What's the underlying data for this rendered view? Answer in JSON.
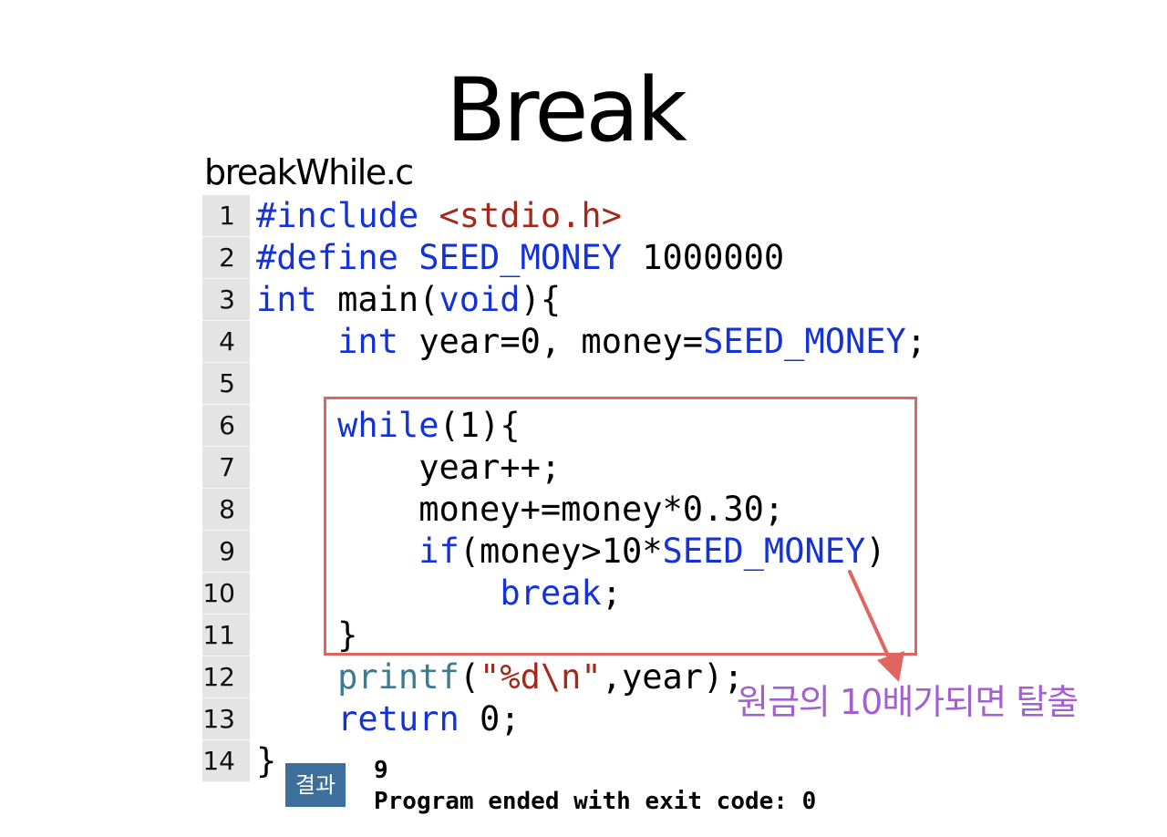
{
  "slide": {
    "title": "Break",
    "filename": "breakWhile.c"
  },
  "code": {
    "lines": [
      {
        "num": "1",
        "tokens": [
          {
            "t": "#include ",
            "c": "kw"
          },
          {
            "t": "<stdio.h>",
            "c": "str"
          }
        ]
      },
      {
        "num": "2",
        "tokens": [
          {
            "t": "#define SEED_MONEY ",
            "c": "kw"
          },
          {
            "t": "1000000",
            "c": ""
          }
        ]
      },
      {
        "num": "3",
        "tokens": [
          {
            "t": "int",
            "c": "kw"
          },
          {
            "t": " main(",
            "c": ""
          },
          {
            "t": "void",
            "c": "kw"
          },
          {
            "t": "){",
            "c": ""
          }
        ]
      },
      {
        "num": "4",
        "tokens": [
          {
            "t": "    ",
            "c": ""
          },
          {
            "t": "int",
            "c": "kw"
          },
          {
            "t": " year=0, money=",
            "c": ""
          },
          {
            "t": "SEED_MONEY",
            "c": "kw"
          },
          {
            "t": ";",
            "c": ""
          }
        ]
      },
      {
        "num": "5",
        "tokens": []
      },
      {
        "num": "6",
        "tokens": [
          {
            "t": "    ",
            "c": ""
          },
          {
            "t": "while",
            "c": "kw"
          },
          {
            "t": "(1){",
            "c": ""
          }
        ]
      },
      {
        "num": "7",
        "tokens": [
          {
            "t": "        year++;",
            "c": ""
          }
        ]
      },
      {
        "num": "8",
        "tokens": [
          {
            "t": "        money+=money*0.30;",
            "c": ""
          }
        ]
      },
      {
        "num": "9",
        "tokens": [
          {
            "t": "        ",
            "c": ""
          },
          {
            "t": "if",
            "c": "kw"
          },
          {
            "t": "(money>10*",
            "c": ""
          },
          {
            "t": "SEED_MONEY",
            "c": "kw"
          },
          {
            "t": ")",
            "c": ""
          }
        ]
      },
      {
        "num": "10",
        "tokens": [
          {
            "t": "            ",
            "c": ""
          },
          {
            "t": "break",
            "c": "kw"
          },
          {
            "t": ";",
            "c": ""
          }
        ]
      },
      {
        "num": "11",
        "tokens": [
          {
            "t": "    }",
            "c": ""
          }
        ]
      },
      {
        "num": "12",
        "tokens": [
          {
            "t": "    ",
            "c": ""
          },
          {
            "t": "printf",
            "c": "fn"
          },
          {
            "t": "(",
            "c": ""
          },
          {
            "t": "\"%d\\n\"",
            "c": "str"
          },
          {
            "t": ",year);",
            "c": ""
          }
        ]
      },
      {
        "num": "13",
        "tokens": [
          {
            "t": "    ",
            "c": ""
          },
          {
            "t": "return",
            "c": "kw"
          },
          {
            "t": " 0;",
            "c": ""
          }
        ]
      },
      {
        "num": "14",
        "tokens": [
          {
            "t": "}",
            "c": ""
          }
        ]
      }
    ]
  },
  "annotation": {
    "text": "원금의 10배가되면 탈출",
    "color": "#a45fd0",
    "box_color": "#e06560"
  },
  "result": {
    "badge_label": "결과",
    "output_lines": [
      "9",
      "Program ended with exit code: 0"
    ]
  },
  "colors": {
    "keyword": "#1432d6",
    "string": "#a3291b",
    "function": "#3b7b94",
    "badge": "#3d6f9c"
  }
}
